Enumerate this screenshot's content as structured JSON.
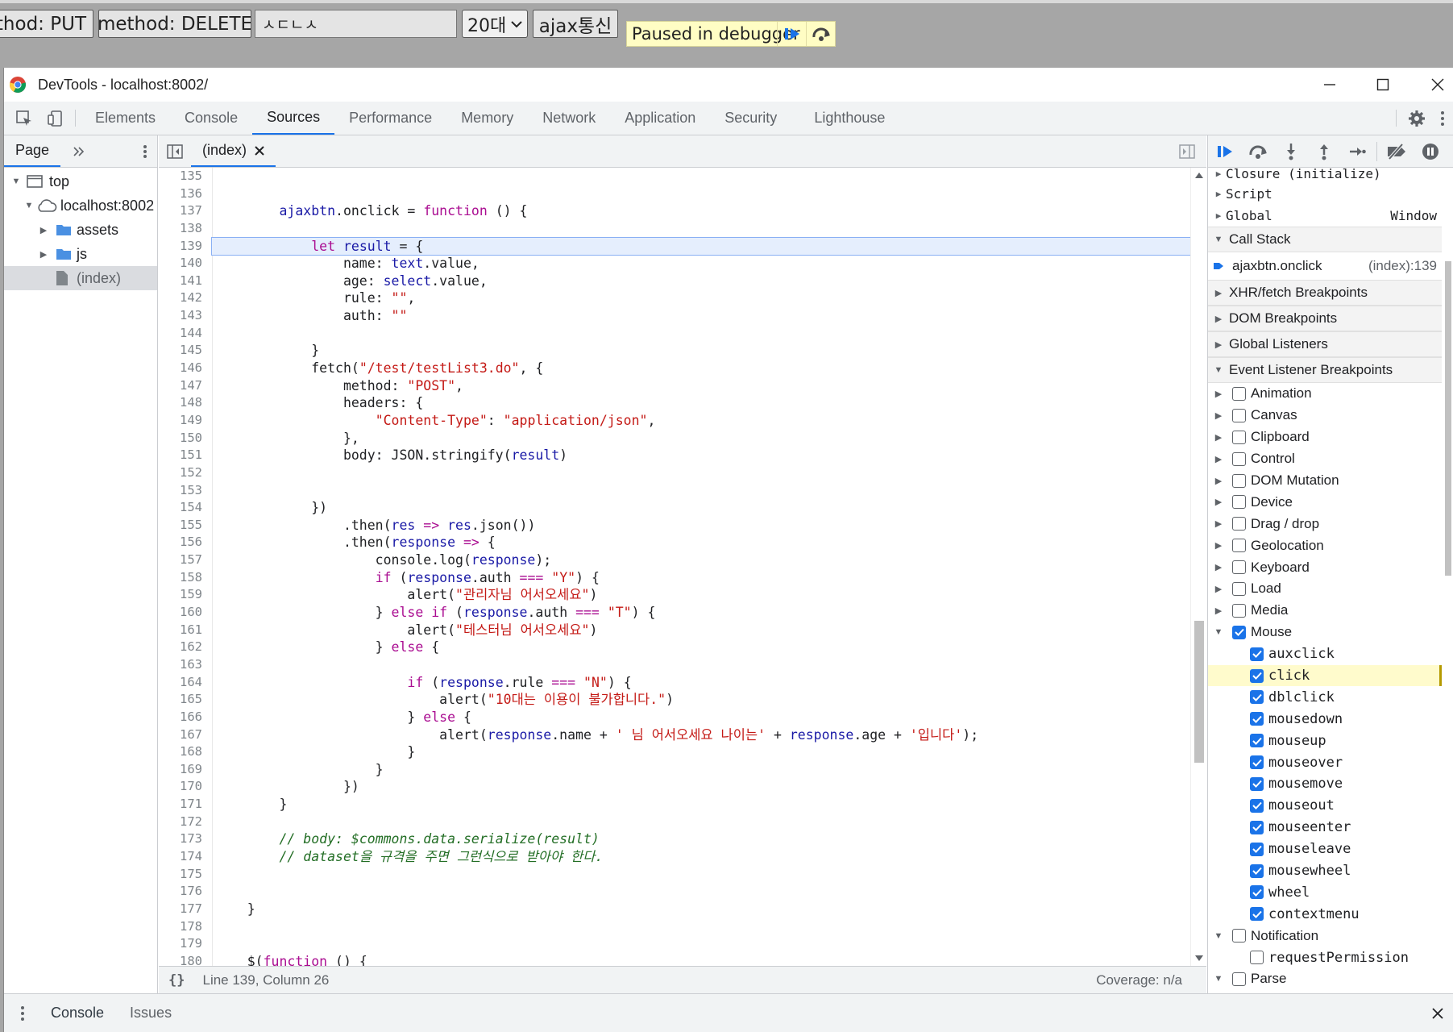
{
  "page": {
    "buttons": [
      "ethod: PUT",
      "method: DELETE"
    ],
    "input_value": "ㅅㄷㄴㅅ",
    "select_value": "20대",
    "ajax_button": "ajax통신",
    "paused_text": "Paused in debugger"
  },
  "window": {
    "title": "DevTools - localhost:8002/"
  },
  "main_tabs": [
    "Elements",
    "Console",
    "Sources",
    "Performance",
    "Memory",
    "Network",
    "Application",
    "Security",
    "Lighthouse"
  ],
  "active_main_tab": "Sources",
  "navigator": {
    "tab": "Page",
    "tree": {
      "top": "top",
      "host": "localhost:8002",
      "assets": "assets",
      "js": "js",
      "index": "(index)"
    }
  },
  "editor": {
    "tab": "(index)",
    "line_numbers": [
      "135",
      "136",
      "137",
      "138",
      "139",
      "140",
      "141",
      "142",
      "143",
      "144",
      "145",
      "146",
      "147",
      "148",
      "149",
      "150",
      "151",
      "152",
      "153",
      "154",
      "155",
      "156",
      "157",
      "158",
      "159",
      "160",
      "161",
      "162",
      "163",
      "164",
      "165",
      "166",
      "167",
      "168",
      "169",
      "170",
      "171",
      "172",
      "173",
      "174",
      "175",
      "176",
      "177",
      "178",
      "179",
      "180"
    ],
    "status_position": "Line 139, Column 26",
    "coverage": "Coverage: n/a"
  },
  "debugger": {
    "scope": {
      "closure": "Closure (initialize)",
      "script": "Script",
      "global": "Global",
      "global_value": "Window"
    },
    "call_stack_label": "Call Stack",
    "call_stack_frame": "ajaxbtn.onclick",
    "call_stack_location": "(index):139",
    "sections": {
      "xhr": "XHR/fetch Breakpoints",
      "dom": "DOM Breakpoints",
      "global": "Global Listeners",
      "event": "Event Listener Breakpoints"
    },
    "event_categories": [
      "Animation",
      "Canvas",
      "Clipboard",
      "Control",
      "DOM Mutation",
      "Device",
      "Drag / drop",
      "Geolocation",
      "Keyboard",
      "Load",
      "Media"
    ],
    "mouse_label": "Mouse",
    "mouse_events": [
      "auxclick",
      "click",
      "dblclick",
      "mousedown",
      "mouseup",
      "mouseover",
      "mousemove",
      "mouseout",
      "mouseenter",
      "mouseleave",
      "mousewheel",
      "wheel",
      "contextmenu"
    ],
    "notification_label": "Notification",
    "notification_child": "requestPermission",
    "parse_label": "Parse"
  },
  "drawer": {
    "console": "Console",
    "issues": "Issues"
  },
  "colors": {
    "accent": "#1a73e8",
    "keyword": "#aa0d91",
    "string": "#c41a16",
    "variable": "#1a1aa6",
    "comment": "#236e25",
    "paused_bg": "#fffdc4"
  }
}
